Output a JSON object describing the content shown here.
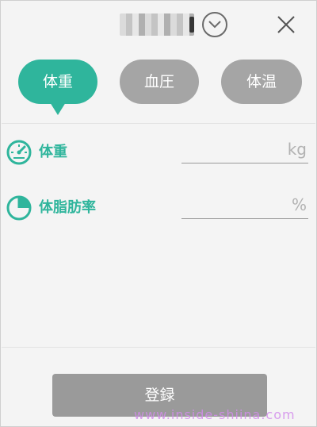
{
  "header": {
    "user_name": "",
    "dropdown_icon": "chevron-down-circle-icon",
    "close_icon": "close-icon"
  },
  "tabs": [
    {
      "label": "体重",
      "active": true
    },
    {
      "label": "血圧",
      "active": false
    },
    {
      "label": "体温",
      "active": false
    }
  ],
  "fields": [
    {
      "label": "体重",
      "icon": "gauge-icon",
      "value": "",
      "unit": "kg"
    },
    {
      "label": "体脂肪率",
      "icon": "pie-chart-icon",
      "value": "",
      "unit": "%"
    }
  ],
  "submit_label": "登録",
  "watermark": "www.inside-shiina.com",
  "colors": {
    "accent": "#2fb59c",
    "tab_inactive": "#a5a5a5",
    "button": "#9a9a9a",
    "background": "#f4f4f4"
  }
}
